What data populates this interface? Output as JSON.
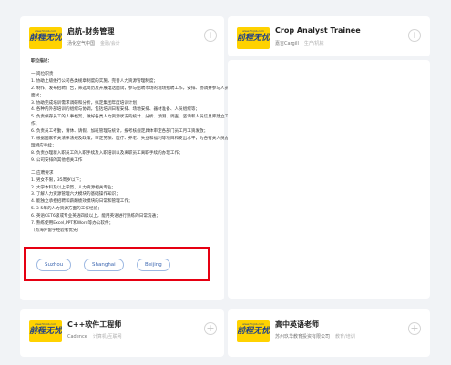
{
  "logo": {
    "url_text": "www.51job.com",
    "brand_text": "前程无忧"
  },
  "card_main": {
    "title": "启航-财务管理",
    "company": "汤化空气中国",
    "meta": "金融/会计",
    "description_heading": "职位描述：",
    "section1_heading": "一.岗位职责",
    "section1_items": [
      "1. 协助上级维行公司各类规章制度的实施，完善人力资源管理制度；",
      "2. 制作，发布招聘广告，筛选简历及开展电话面试，参与招聘市场的现场招聘工作，安排、协调并参与人员面试；",
      "3. 协助完成培训需求调研和分析，拟定集团年度培训计划；",
      "4. 各种内外部培训的组织与协调，包括培训日程安排、场地安排、器材准备、人员组织等；",
      "5. 负责保存员工的人事档案，做好各类人力资源状况的统计、分析、预测、调查、咨询和人员信息库建立工作；",
      "6. 负责员工考勤，请休、请假、加班管理与统计，报考核规定具体审定各部门员工月工资发放；",
      "7. 根据国家有关法律法规及政策，审定劳保、医疗、养老、失业和福利等项目和支出水平，为各有关人员办理相应手续；",
      "8. 负责办理新入职员工的入职手续及入职培训以及离职员工离职手续的办理工作；",
      "9. 公司安排的其他相关工作"
    ],
    "section2_heading": "二.应聘要求",
    "section2_items": [
      "1. 男女不限，35周岁以下；",
      "2. 大学本科及以上学历，人力资源相关专业；",
      "3. 了解人力资源管理六大模块的基础操作知识；",
      "4. 能独立承担招聘和薪酬绩效模块的日常和管理工作；",
      "5. 3-5年的人力资源方面的工作经验；",
      "6. 英语CET6级或专业英语四级以上，能用英语进行熟练的日常沟通；",
      "7. 熟练使用Excel,PPT和Word等办公软件；",
      "（有海外留学经验者优先）"
    ],
    "locations": [
      "Suzhou",
      "Shanghai",
      "Beijing"
    ]
  },
  "card_right_top": {
    "title": "Crop Analyst Trainee",
    "company": "嘉吉Cargill",
    "meta": "生产/机械"
  },
  "card_bottom_left": {
    "title": "C++软件工程师",
    "company": "Cadence",
    "meta": "计算机/互联网"
  },
  "card_bottom_right": {
    "title": "高中英语老师",
    "company": "苏州玖华教育投资有限公司",
    "meta": "教育/培训"
  },
  "add_symbol": "+",
  "colors": {
    "highlight": "#e60012",
    "chip_border": "#9db8e2",
    "chip_text": "#3c66b0",
    "logo_bg": "#ffd200"
  }
}
